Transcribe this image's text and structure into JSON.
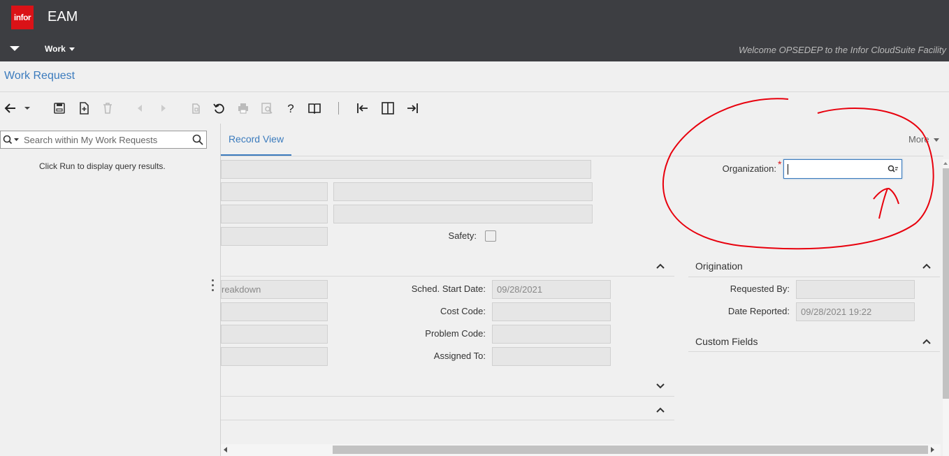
{
  "app": {
    "logo_text": "infor",
    "title": "EAM",
    "brand_color": "#da1217"
  },
  "nav": {
    "menu_label": "Work",
    "welcome_text": "Welcome OPSEDEP to the Infor CloudSuite Facility"
  },
  "page": {
    "title": "Work Request"
  },
  "toolbar": {
    "icons": [
      "back-arrow-icon",
      "save-icon",
      "new-record-icon",
      "delete-icon",
      "previous-icon",
      "next-icon",
      "copy-icon",
      "refresh-icon",
      "print-icon",
      "preview-icon",
      "help-icon",
      "book-icon",
      "collapse-left-icon",
      "split-view-icon",
      "expand-right-icon"
    ]
  },
  "list_panel": {
    "search_placeholder": "Search within My Work Requests",
    "empty_message": "Click Run to display query results."
  },
  "record": {
    "tab_label": "Record View",
    "more_label": "More",
    "organization_label": "Organization:",
    "organization_value": "",
    "safety_label": "Safety:",
    "type_value_partial": "reakdown",
    "sched_start_label": "Sched. Start Date:",
    "sched_start_value": "09/28/2021",
    "cost_code_label": "Cost Code:",
    "problem_code_label": "Problem Code:",
    "assigned_to_label": "Assigned To:"
  },
  "origination": {
    "title": "Origination",
    "requested_by_label": "Requested By:",
    "requested_by_value": "",
    "date_reported_label": "Date Reported:",
    "date_reported_value": "09/28/2021 19:22"
  },
  "custom_fields": {
    "title": "Custom Fields"
  },
  "colors": {
    "accent": "#3b7bbd",
    "topbar": "#3d3e42",
    "annotation": "#e8000d"
  }
}
